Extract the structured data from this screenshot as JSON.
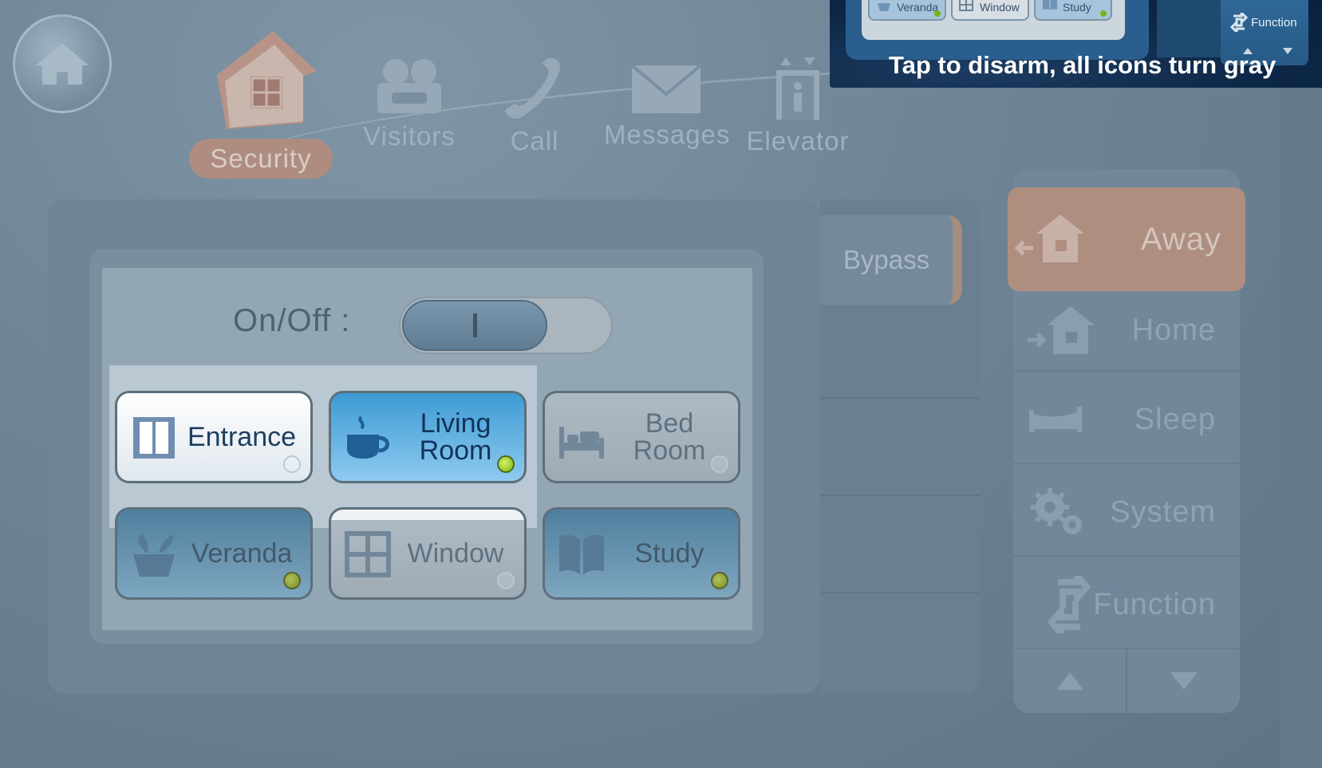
{
  "nav": {
    "items": [
      {
        "key": "security",
        "label": "Security",
        "active": true
      },
      {
        "key": "visitors",
        "label": "Visitors",
        "active": false
      },
      {
        "key": "call",
        "label": "Call",
        "active": false
      },
      {
        "key": "messages",
        "label": "Messages",
        "active": false
      },
      {
        "key": "elevator",
        "label": "Elevator",
        "active": false
      }
    ],
    "home_icon": "home-icon"
  },
  "bypass": {
    "label": "Bypass"
  },
  "onoff": {
    "label": "On/Off :",
    "state": "on"
  },
  "zones": [
    {
      "label": "Entrance",
      "icon": "door-icon",
      "armed": false
    },
    {
      "label": "Living Room",
      "icon": "cup-icon",
      "armed": true
    },
    {
      "label": "Bed Room",
      "icon": "bed-icon",
      "armed": false
    },
    {
      "label": "Veranda",
      "icon": "plant-icon",
      "armed": true
    },
    {
      "label": "Window",
      "icon": "window-icon",
      "armed": false
    },
    {
      "label": "Study",
      "icon": "book-icon",
      "armed": true
    }
  ],
  "modes": [
    {
      "label": "Away",
      "icon": "away-house-icon",
      "active": true
    },
    {
      "label": "Home",
      "icon": "home-arrive-icon",
      "active": false
    },
    {
      "label": "Sleep",
      "icon": "bed-icon",
      "active": false
    },
    {
      "label": "System",
      "icon": "gears-icon",
      "active": false
    },
    {
      "label": "Function",
      "icon": "refresh-icon",
      "active": false
    }
  ],
  "tooltip": {
    "text": "Tap to disarm, all icons turn gray",
    "zones": [
      "Veranda",
      "Window",
      "Study"
    ],
    "function_label": "Function"
  },
  "colors": {
    "accent_orange": "#ad8e7f",
    "armed_blue": "#3d9ad3",
    "led_green": "#7ab215",
    "tooltip_bg": "#0d2746"
  }
}
